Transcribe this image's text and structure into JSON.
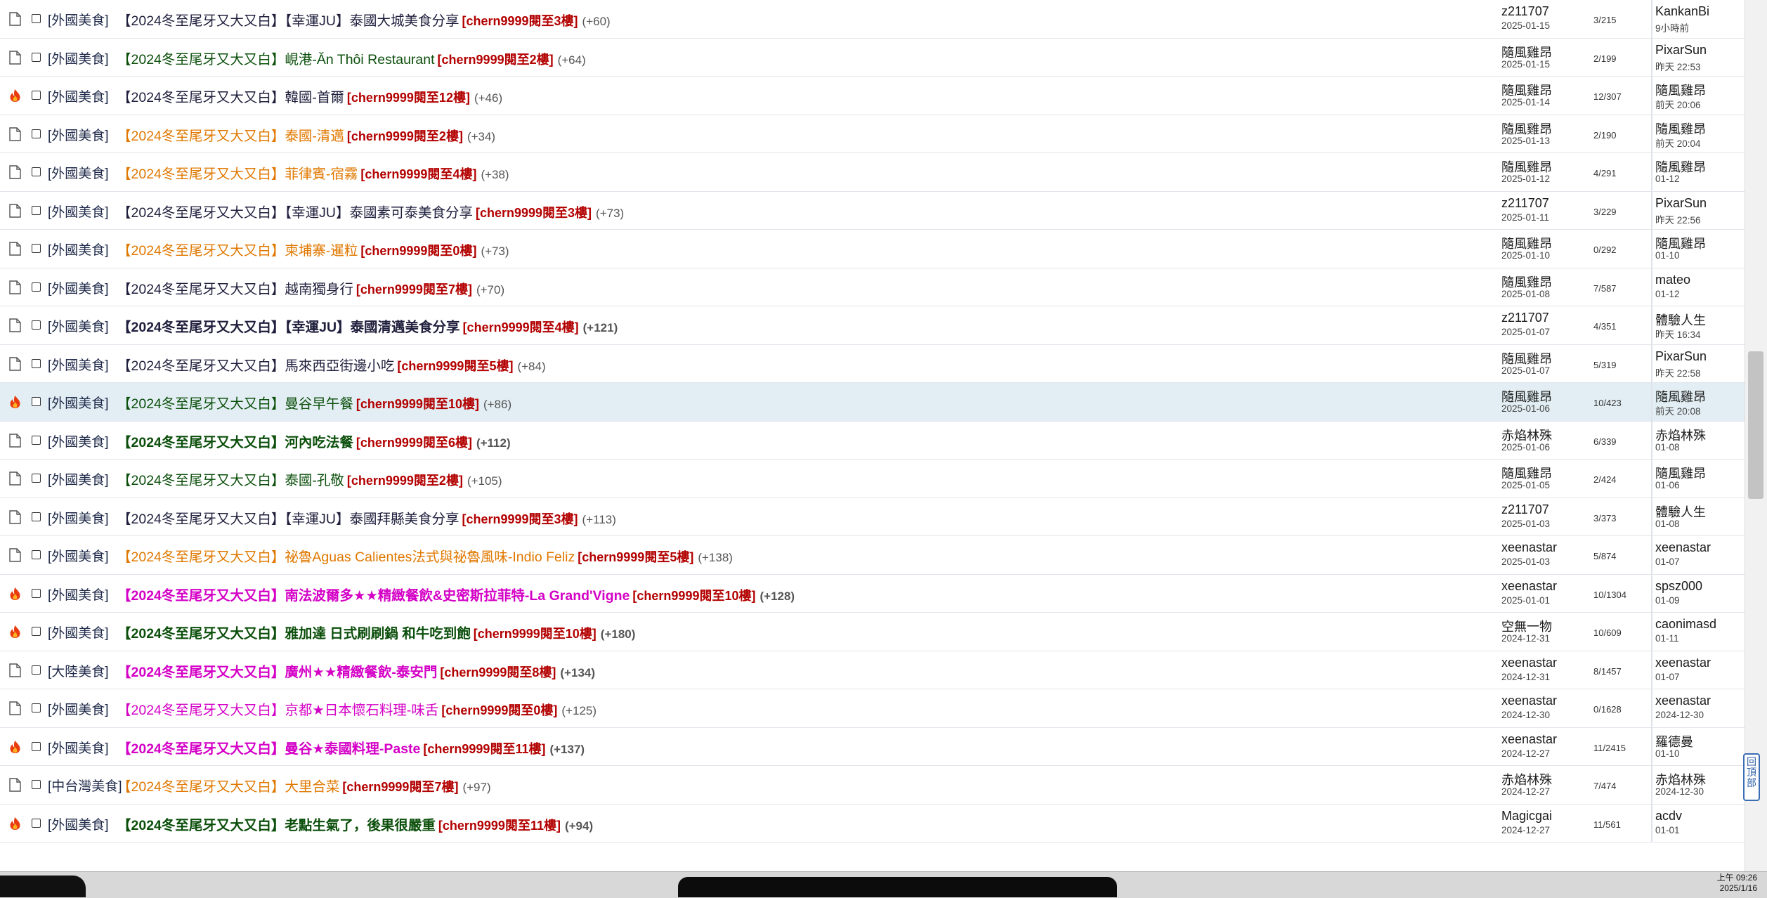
{
  "colors": {
    "floor_red": "#b30000",
    "highlight_row": "#e2eef3",
    "title_dark": "#1f1f3d",
    "title_green": "#0b4f0b",
    "title_orange": "#e07800",
    "title_magenta": "#d400c6"
  },
  "scroll": {
    "back_to_top_label": "回頂部"
  },
  "taskbar": {
    "time": "上午 09:26",
    "date": "2025/1/16"
  },
  "threads": [
    {
      "icon": "doc-icon",
      "category": "[外國美食]",
      "title": "【2024冬至尾牙又大又白】【幸運JU】泰國大城美食分享",
      "color": "dk",
      "bold": false,
      "floor": "[chern9999閱至3樓]",
      "plus": "(+60)",
      "author": "z211707",
      "author_date": "2025-01-15",
      "counts": "3/215",
      "last_author": "KankanBi",
      "last_time": "9小時前",
      "highlight": false
    },
    {
      "icon": "doc-icon",
      "category": "[外國美食]",
      "title": "【2024冬至尾牙又大又白】峴港-Ăn Thôi Restaurant",
      "color": "gr",
      "bold": false,
      "floor": "[chern9999閱至2樓]",
      "plus": "(+64)",
      "author": "隨風雞昂",
      "author_date": "2025-01-15",
      "counts": "2/199",
      "last_author": "PixarSun",
      "last_time": "昨天 22:53",
      "highlight": false
    },
    {
      "icon": "flame-icon",
      "category": "[外國美食]",
      "title": "【2024冬至尾牙又大又白】韓國-首爾",
      "color": "dk",
      "bold": false,
      "floor": "[chern9999閱至12樓]",
      "plus": "(+46)",
      "author": "隨風雞昂",
      "author_date": "2025-01-14",
      "counts": "12/307",
      "last_author": "隨風雞昂",
      "last_time": "前天 20:06",
      "highlight": false
    },
    {
      "icon": "doc-icon",
      "category": "[外國美食]",
      "title": "【2024冬至尾牙又大又白】泰國-清邁",
      "color": "or",
      "bold": false,
      "floor": "[chern9999閱至2樓]",
      "plus": "(+34)",
      "author": "隨風雞昂",
      "author_date": "2025-01-13",
      "counts": "2/190",
      "last_author": "隨風雞昂",
      "last_time": "前天 20:04",
      "highlight": false
    },
    {
      "icon": "doc-icon",
      "category": "[外國美食]",
      "title": "【2024冬至尾牙又大又白】菲律賓-宿霧",
      "color": "or",
      "bold": false,
      "floor": "[chern9999閱至4樓]",
      "plus": "(+38)",
      "author": "隨風雞昂",
      "author_date": "2025-01-12",
      "counts": "4/291",
      "last_author": "隨風雞昂",
      "last_time": "01-12",
      "highlight": false
    },
    {
      "icon": "doc-icon",
      "category": "[外國美食]",
      "title": "【2024冬至尾牙又大又白】【幸運JU】泰國素可泰美食分享",
      "color": "dk",
      "bold": false,
      "floor": "[chern9999閱至3樓]",
      "plus": "(+73)",
      "author": "z211707",
      "author_date": "2025-01-11",
      "counts": "3/229",
      "last_author": "PixarSun",
      "last_time": "昨天 22:56",
      "highlight": false
    },
    {
      "icon": "doc-icon",
      "category": "[外國美食]",
      "title": "【2024冬至尾牙又大又白】柬埔寨-暹粒",
      "color": "or",
      "bold": false,
      "floor": "[chern9999閱至0樓]",
      "plus": "(+73)",
      "author": "隨風雞昂",
      "author_date": "2025-01-10",
      "counts": "0/292",
      "last_author": "隨風雞昂",
      "last_time": "01-10",
      "highlight": false
    },
    {
      "icon": "doc-icon",
      "category": "[外國美食]",
      "title": "【2024冬至尾牙又大又白】越南獨身行",
      "color": "dk",
      "bold": false,
      "floor": "[chern9999閱至7樓]",
      "plus": "(+70)",
      "author": "隨風雞昂",
      "author_date": "2025-01-08",
      "counts": "7/587",
      "last_author": "mateo",
      "last_time": "01-12",
      "highlight": false
    },
    {
      "icon": "doc-icon",
      "category": "[外國美食]",
      "title": "【2024冬至尾牙又大又白】【幸運JU】泰國清邁美食分享",
      "color": "dk",
      "bold": true,
      "floor": "[chern9999閱至4樓]",
      "plus": "(+121)",
      "author": "z211707",
      "author_date": "2025-01-07",
      "counts": "4/351",
      "last_author": "體驗人生",
      "last_time": "昨天 16:34",
      "highlight": false
    },
    {
      "icon": "doc-icon",
      "category": "[外國美食]",
      "title": "【2024冬至尾牙又大又白】馬來西亞街邊小吃",
      "color": "dk",
      "bold": false,
      "floor": "[chern9999閱至5樓]",
      "plus": "(+84)",
      "author": "隨風雞昂",
      "author_date": "2025-01-07",
      "counts": "5/319",
      "last_author": "PixarSun",
      "last_time": "昨天 22:58",
      "highlight": false
    },
    {
      "icon": "flame-icon",
      "category": "[外國美食]",
      "title": "【2024冬至尾牙又大又白】曼谷早午餐",
      "color": "gr",
      "bold": false,
      "floor": "[chern9999閱至10樓]",
      "plus": "(+86)",
      "author": "隨風雞昂",
      "author_date": "2025-01-06",
      "counts": "10/423",
      "last_author": "隨風雞昂",
      "last_time": "前天 20:08",
      "highlight": true
    },
    {
      "icon": "doc-icon",
      "category": "[外國美食]",
      "title": "【2024冬至尾牙又大又白】河內吃法餐",
      "color": "gr",
      "bold": true,
      "floor": "[chern9999閱至6樓]",
      "plus": "(+112)",
      "author": "赤焰林殊",
      "author_date": "2025-01-06",
      "counts": "6/339",
      "last_author": "赤焰林殊",
      "last_time": "01-08",
      "highlight": false
    },
    {
      "icon": "doc-icon",
      "category": "[外國美食]",
      "title": "【2024冬至尾牙又大又白】泰國-孔敬",
      "color": "gr",
      "bold": false,
      "floor": "[chern9999閱至2樓]",
      "plus": "(+105)",
      "author": "隨風雞昂",
      "author_date": "2025-01-05",
      "counts": "2/424",
      "last_author": "隨風雞昂",
      "last_time": "01-06",
      "highlight": false
    },
    {
      "icon": "doc-icon",
      "category": "[外國美食]",
      "title": "【2024冬至尾牙又大又白】【幸運JU】泰國拜縣美食分享",
      "color": "dk",
      "bold": false,
      "floor": "[chern9999閱至3樓]",
      "plus": "(+113)",
      "author": "z211707",
      "author_date": "2025-01-03",
      "counts": "3/373",
      "last_author": "體驗人生",
      "last_time": "01-08",
      "highlight": false
    },
    {
      "icon": "doc-icon",
      "category": "[外國美食]",
      "title": "【2024冬至尾牙又大又白】祕魯Aguas Calientes法式與祕魯風味-Indio Feliz",
      "color": "or",
      "bold": false,
      "floor": "[chern9999閱至5樓]",
      "plus": "(+138)",
      "author": "xeenastar",
      "author_date": "2025-01-03",
      "counts": "5/874",
      "last_author": "xeenastar",
      "last_time": "01-07",
      "highlight": false
    },
    {
      "icon": "flame-icon",
      "category": "[外國美食]",
      "title": "【2024冬至尾牙又大又白】南法波爾多★★精緻餐飲&史密斯拉菲特-La Grand'Vigne",
      "color": "mg",
      "bold": true,
      "floor": "[chern9999閱至10樓]",
      "plus": "(+128)",
      "author": "xeenastar",
      "author_date": "2025-01-01",
      "counts": "10/1304",
      "last_author": "spsz000",
      "last_time": "01-09",
      "highlight": false
    },
    {
      "icon": "flame-icon",
      "category": "[外國美食]",
      "title": "【2024冬至尾牙又大又白】雅加達 日式刷刷鍋 和牛吃到飽",
      "color": "gr",
      "bold": true,
      "floor": "[chern9999閱至10樓]",
      "plus": "(+180)",
      "author": "空無一物",
      "author_date": "2024-12-31",
      "counts": "10/609",
      "last_author": "caonimasd",
      "last_time": "01-11",
      "highlight": false
    },
    {
      "icon": "doc-icon",
      "category": "[大陸美食]",
      "title": "【2024冬至尾牙又大又白】廣州★★精緻餐飲-泰安門",
      "color": "mg",
      "bold": true,
      "floor": "[chern9999閱至8樓]",
      "plus": "(+134)",
      "author": "xeenastar",
      "author_date": "2024-12-31",
      "counts": "8/1457",
      "last_author": "xeenastar",
      "last_time": "01-07",
      "highlight": false
    },
    {
      "icon": "doc-icon",
      "category": "[外國美食]",
      "title": "【2024冬至尾牙又大又白】京都★日本懷石料理-味舌",
      "color": "mg",
      "bold": false,
      "floor": "[chern9999閱至0樓]",
      "plus": "(+125)",
      "author": "xeenastar",
      "author_date": "2024-12-30",
      "counts": "0/1628",
      "last_author": "xeenastar",
      "last_time": "2024-12-30",
      "highlight": false
    },
    {
      "icon": "flame-icon",
      "category": "[外國美食]",
      "title": "【2024冬至尾牙又大又白】曼谷★泰國料理-Paste",
      "color": "mg",
      "bold": true,
      "floor": "[chern9999閱至11樓]",
      "plus": "(+137)",
      "author": "xeenastar",
      "author_date": "2024-12-27",
      "counts": "11/2415",
      "last_author": "羅德曼",
      "last_time": "01-10",
      "highlight": false
    },
    {
      "icon": "doc-icon",
      "category": "[中台灣美食]",
      "title": "【2024冬至尾牙又大又白】大里合菜",
      "color": "or",
      "bold": false,
      "floor": "[chern9999閱至7樓]",
      "plus": "(+97)",
      "author": "赤焰林殊",
      "author_date": "2024-12-27",
      "counts": "7/474",
      "last_author": "赤焰林殊",
      "last_time": "2024-12-30",
      "highlight": false
    },
    {
      "icon": "flame-icon",
      "category": "[外國美食]",
      "title": "【2024冬至尾牙又大又白】老點生氣了，後果很嚴重",
      "color": "gr",
      "bold": true,
      "floor": "[chern9999閱至11樓]",
      "plus": "(+94)",
      "author": "Magicgai",
      "author_date": "2024-12-27",
      "counts": "11/561",
      "last_author": "acdv",
      "last_time": "01-01",
      "highlight": false
    }
  ]
}
